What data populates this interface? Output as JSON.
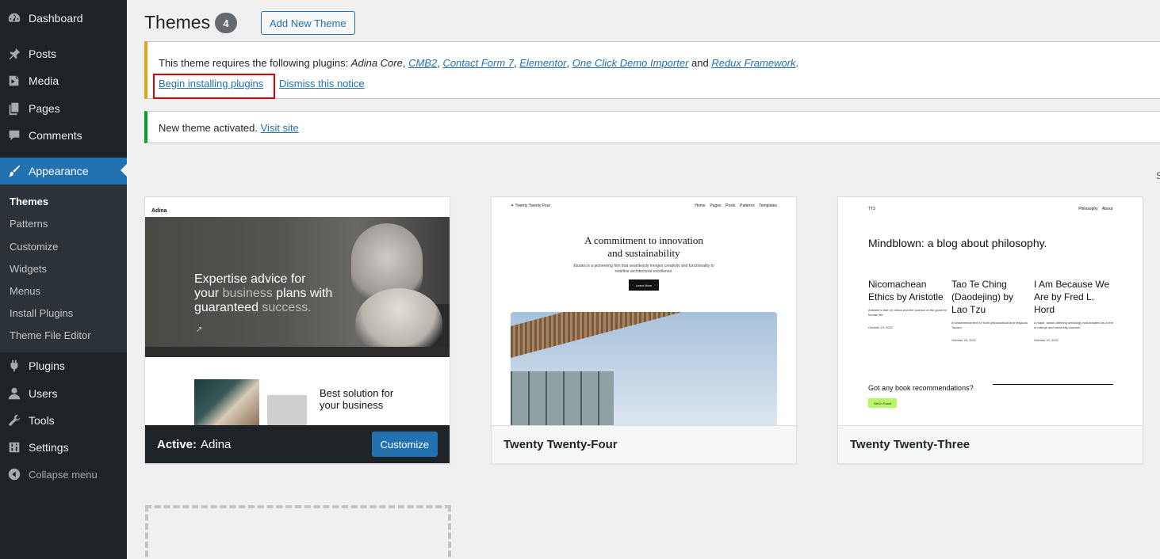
{
  "sidebar": {
    "items": [
      {
        "label": "Dashboard",
        "icon": "dashboard-icon"
      },
      {
        "label": "Posts",
        "icon": "pin-icon"
      },
      {
        "label": "Media",
        "icon": "media-icon"
      },
      {
        "label": "Pages",
        "icon": "pages-icon"
      },
      {
        "label": "Comments",
        "icon": "comment-icon"
      },
      {
        "label": "Appearance",
        "icon": "brush-icon"
      },
      {
        "label": "Plugins",
        "icon": "plug-icon"
      },
      {
        "label": "Users",
        "icon": "user-icon"
      },
      {
        "label": "Tools",
        "icon": "wrench-icon"
      },
      {
        "label": "Settings",
        "icon": "settings-icon"
      }
    ],
    "submenu": [
      "Themes",
      "Patterns",
      "Customize",
      "Widgets",
      "Menus",
      "Install Plugins",
      "Theme File Editor"
    ],
    "collapse_label": "Collapse menu"
  },
  "header": {
    "title": "Themes",
    "count": "4",
    "add_new_label": "Add New Theme"
  },
  "notice_plugins": {
    "prefix": "This theme requires the following plugins: ",
    "first_plugin": "Adina Core",
    "links": [
      "CMB2",
      "Contact Form 7",
      "Elementor",
      "One Click Demo Importer"
    ],
    "and_text": " and ",
    "last_link": "Redux Framework",
    "period": ".",
    "begin_label": "Begin installing plugins",
    "dismiss_label": "Dismiss this notice"
  },
  "notice_activated": {
    "text": "New theme activated. ",
    "link": "Visit site"
  },
  "right_edge_char": "S",
  "themes": [
    {
      "active_label": "Active:",
      "name": "Adina",
      "button": "Customize",
      "shot": {
        "logo": "Adina",
        "headline_1": "Expertise advice for",
        "headline_2a": "your ",
        "headline_2b": "business",
        "headline_2c": " plans with",
        "headline_3a": "guaranteed ",
        "headline_3b": "success.",
        "solution_1": "Best solution for",
        "solution_2": "your business"
      }
    },
    {
      "name": "Twenty Twenty-Four",
      "shot": {
        "site": "Twenty Twenty Four",
        "nav": "Home    Pages    Posts    Patterns    Templates",
        "title_1": "A commitment to innovation",
        "title_2": "and sustainability",
        "sub": "Études is a pioneering firm that seamlessly merges creativity and functionality to redefine architectural excellence.",
        "button": "Learn More"
      }
    },
    {
      "name": "Twenty Twenty-Three",
      "shot": {
        "site": "TT3",
        "nav": "Philosophy    About",
        "headline": "Mindblown: a blog about philosophy.",
        "posts": [
          {
            "title": "Nicomachean Ethics by Aristotle",
            "desc": "Aristotle's take on ethics and the science of the good for human life.",
            "date": "October 19, 2022"
          },
          {
            "title": "Tao Te Ching (Daodejing) by Lao Tzu",
            "desc": "A fundamental text for both philosophical and religious Taoism.",
            "date": "October 18, 2022"
          },
          {
            "title": "I Am Because We Are by Fred L. Hord",
            "desc": "A major, canon-defining anthology and adopted as a text in college and university courses.",
            "date": "October 19, 2022"
          }
        ],
        "question": "Got any book recommendations?",
        "button": "Get In Touch"
      }
    }
  ],
  "colors": {
    "sidebar_bg": "#1d2327",
    "accent": "#2271b1",
    "warning": "#dba617",
    "success": "#00a32a",
    "highlight_box": "#dd0000"
  }
}
